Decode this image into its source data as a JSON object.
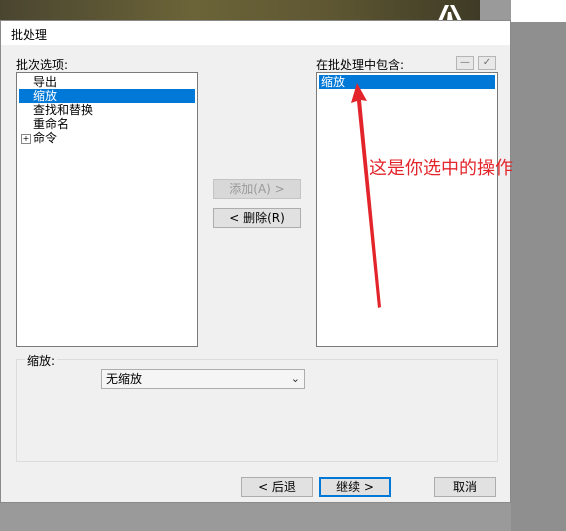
{
  "window": {
    "title": "批处理"
  },
  "left_panel": {
    "label": "批次选项:",
    "items": [
      {
        "label": "导出"
      },
      {
        "label": "缩放"
      },
      {
        "label": "查找和替换"
      },
      {
        "label": "重命名"
      },
      {
        "label": "命令"
      }
    ],
    "selected_index": 1
  },
  "right_panel": {
    "label": "在批处理中包含:",
    "items": [
      {
        "label": "缩放"
      }
    ],
    "minus_label": "—",
    "check_label": "✓"
  },
  "buttons": {
    "add": "添加(A) >",
    "remove": "< 删除(R)",
    "back": "< 后退",
    "continue": "继续 >",
    "cancel": "取消"
  },
  "scale": {
    "label": "缩放:",
    "selected": "无缩放"
  },
  "annotation": {
    "text": "这是你选中的操作",
    "color": "#e3252b"
  },
  "colors": {
    "selection": "#0078d7"
  }
}
